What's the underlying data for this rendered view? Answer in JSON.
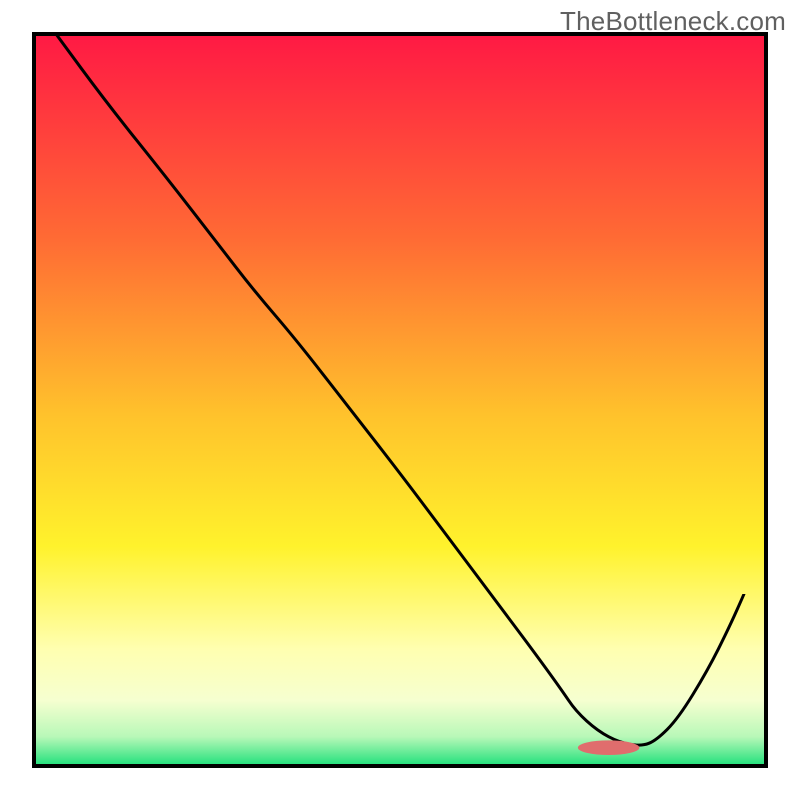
{
  "watermark": "TheBottleneck.com",
  "chart_data": {
    "type": "line",
    "title": "",
    "xlabel": "",
    "ylabel": "",
    "xlim": [
      0,
      100
    ],
    "ylim": [
      0,
      100
    ],
    "grid": false,
    "legend": false,
    "background_gradient": {
      "direction": "vertical",
      "stops": [
        {
          "pos": 0.0,
          "color": "#ff1944"
        },
        {
          "pos": 0.28,
          "color": "#ff6b34"
        },
        {
          "pos": 0.52,
          "color": "#ffc22c"
        },
        {
          "pos": 0.7,
          "color": "#fff22c"
        },
        {
          "pos": 0.84,
          "color": "#ffffb0"
        },
        {
          "pos": 0.91,
          "color": "#f6ffd0"
        },
        {
          "pos": 0.96,
          "color": "#b8f8b8"
        },
        {
          "pos": 1.0,
          "color": "#1ee07a"
        }
      ]
    },
    "frame_color": "#000000",
    "frame_width": 4,
    "series": [
      {
        "name": "curve",
        "color": "#000000",
        "width": 3,
        "x": [
          3,
          10,
          18,
          25,
          30,
          36,
          43,
          50,
          56,
          62,
          68,
          72,
          74,
          77,
          80,
          83,
          85,
          88,
          92,
          95,
          97
        ],
        "y": [
          100,
          90.5,
          80.5,
          71.5,
          65.0,
          58.0,
          49.0,
          40.0,
          32.0,
          24.0,
          16.0,
          10.5,
          7.5,
          4.8,
          3.2,
          2.7,
          3.5,
          6.5,
          13.0,
          19.0,
          23.5
        ]
      }
    ],
    "marker": {
      "name": "minimum-marker",
      "color": "#e06d6d",
      "approx_x_range": [
        75,
        82
      ],
      "approx_y": 2.5,
      "rx_frac": 4.2,
      "ry_frac": 1.0
    }
  }
}
